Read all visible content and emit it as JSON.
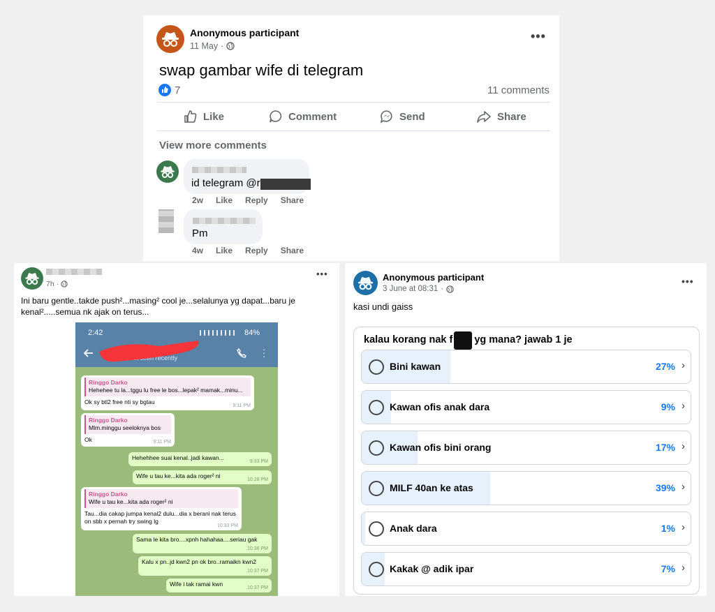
{
  "post1": {
    "author": "Anonymous participant",
    "date": "11 May",
    "date_sep": "·",
    "text": "swap gambar wife di telegram",
    "reactions_count": "7",
    "comments_count": "11 comments",
    "actions": {
      "like": "Like",
      "comment": "Comment",
      "send": "Send",
      "share": "Share"
    },
    "view_more": "View more comments",
    "comments": [
      {
        "text": "id telegram @r",
        "time": "2w",
        "like": "Like",
        "reply": "Reply",
        "share": "Share"
      },
      {
        "text": "Pm",
        "time": "4w",
        "like": "Like",
        "reply": "Reply",
        "share": "Share"
      }
    ]
  },
  "post2": {
    "time": "7h",
    "date_sep": "·",
    "text": "Ini baru gentle..takde push²...masing² cool je...selalunya yg dapat...baru je kenal².....semua nk ajak on terus...",
    "phone": {
      "clock": "2:42",
      "battery": "84%",
      "last_seen": "last seen recently"
    },
    "messages": [
      {
        "quote_name": "Ringgo Darko",
        "quote_text": "Hehehee tu la...tggu lu free le bos...lepak² mamak...minu...",
        "text": "Ok sy btl2 free nti sy bgtau",
        "time": "9:11 PM"
      },
      {
        "quote_name": "Ringgo Darko",
        "quote_text": "Mlm.minggu seeloknya bos",
        "text": "Ok",
        "time": "9:11 PM"
      },
      {
        "text": "Hehehhee suai kenal..jadi kawan...",
        "time": "9:33 PM"
      },
      {
        "text": "Wife u tau ke...kita ada roger² ni",
        "time": "10:28 PM"
      },
      {
        "quote_name": "Ringgo Darko",
        "quote_text": "Wife u tau ke...kita ada roger² ni",
        "text": "Tau...dia cakap jumpa kenal2 dulu...dia x berani nak terus on sbb x pernah try swing lg",
        "time": "10:33 PM"
      },
      {
        "text": "Sama le kita bro....xpnh hahahaa....seriau gak",
        "time": "10:36 PM"
      },
      {
        "text": "Kalu x pn..jd kwn2 pn ok bro..ramaikn kwn2",
        "time": "10:37 PM"
      },
      {
        "text": "Wife i tak ramai kwn",
        "time": "10:37 PM"
      }
    ]
  },
  "post3": {
    "author": "Anonymous participant",
    "date": "3 June at 08:31",
    "date_sep": "·",
    "text": "kasi undi gaiss",
    "poll": {
      "question_start": "kalau korang nak f",
      "question_end": "yg mana? jawab 1 je",
      "options": [
        {
          "label": "Bini kawan",
          "percent": 27,
          "percent_text": "27%"
        },
        {
          "label": "Kawan ofis anak dara",
          "percent": 9,
          "percent_text": "9%"
        },
        {
          "label": "Kawan ofis bini orang",
          "percent": 17,
          "percent_text": "17%"
        },
        {
          "label": "MILF 40an ke atas",
          "percent": 39,
          "percent_text": "39%"
        },
        {
          "label": "Anak dara",
          "percent": 1,
          "percent_text": "1%"
        },
        {
          "label": "Kakak @ adik ipar",
          "percent": 7,
          "percent_text": "7%"
        }
      ]
    }
  },
  "colors": {
    "accent": "#1877f2",
    "poll_fill": "#e7f1fb",
    "avatar_orange": "#c4561a",
    "avatar_green": "#3c7a4e",
    "avatar_blue": "#1d6fa8"
  },
  "icons": [
    "incognito-icon",
    "globe-icon",
    "like-reaction-icon",
    "like-icon",
    "comment-icon",
    "messenger-icon",
    "share-icon",
    "more-options-icon",
    "back-arrow-icon",
    "phone-call-icon",
    "radio-icon",
    "chevron-right-icon"
  ]
}
